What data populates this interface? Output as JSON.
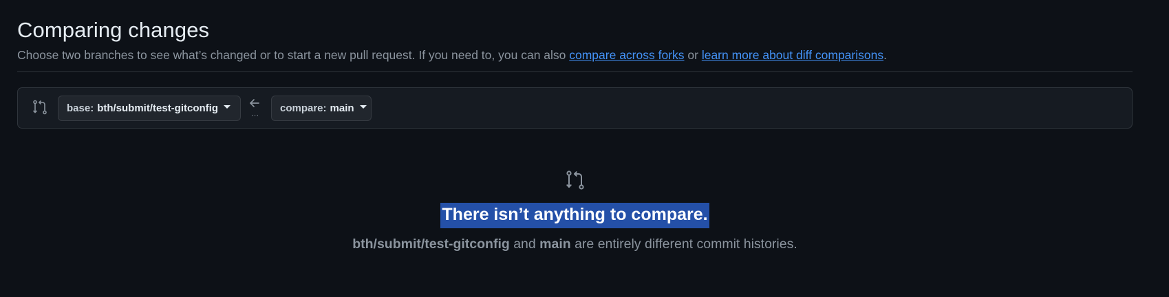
{
  "header": {
    "title": "Comparing changes",
    "subtitle_prefix": "Choose two branches to see what’s changed or to start a new pull request. If you need to, you can also ",
    "link_compare_forks": "compare across forks",
    "subtitle_or": " or ",
    "link_learn_more": "learn more about diff comparisons",
    "subtitle_end": "."
  },
  "range": {
    "base_prefix": "base:",
    "base_value": "bth/submit/test-gitconfig",
    "compare_prefix": "compare:",
    "compare_value": "main",
    "dots": "..."
  },
  "blankslate": {
    "title": "There isn’t anything to compare.",
    "branch_a": "bth/submit/test-gitconfig",
    "and_text": " and ",
    "branch_b": "main",
    "desc_end": " are entirely different commit histories."
  },
  "colors": {
    "background": "#0d1117",
    "link": "#4493f8",
    "selection": "#2450a8"
  }
}
